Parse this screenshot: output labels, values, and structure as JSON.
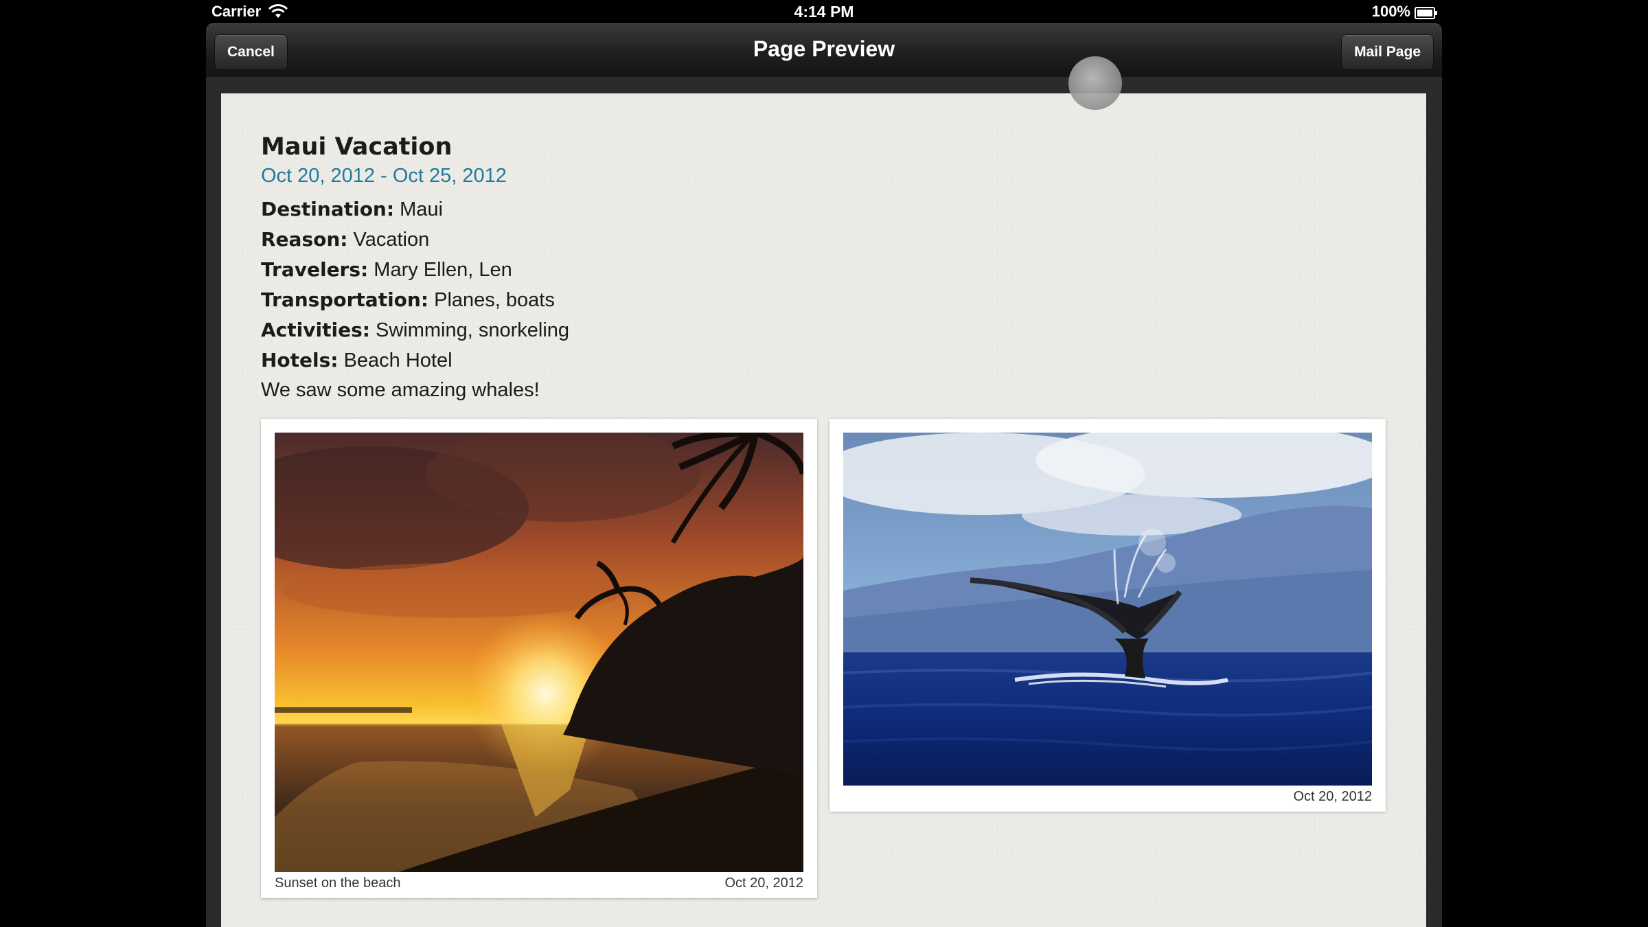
{
  "status_bar": {
    "carrier": "Carrier",
    "time": "4:14 PM",
    "battery": "100%",
    "wifi_icon": "wifi-icon",
    "battery_icon": "battery-icon"
  },
  "nav_bar": {
    "title": "Page Preview",
    "cancel_label": "Cancel",
    "mail_label": "Mail Page"
  },
  "page": {
    "title": "Maui Vacation",
    "dates": "Oct 20, 2012 - Oct 25, 2012",
    "fields": [
      {
        "label": "Destination:",
        "value": "Maui"
      },
      {
        "label": "Reason:",
        "value": "Vacation"
      },
      {
        "label": "Travelers:",
        "value": "Mary Ellen, Len"
      },
      {
        "label": "Transportation:",
        "value": "Planes, boats"
      },
      {
        "label": "Activities:",
        "value": "Swimming, snorkeling"
      },
      {
        "label": "Hotels:",
        "value": "Beach Hotel"
      }
    ],
    "note": "We saw some amazing whales!",
    "photos": [
      {
        "caption": "Sunset on the beach",
        "date": "Oct 20, 2012"
      },
      {
        "caption": "",
        "date": "Oct 20, 2012"
      }
    ]
  },
  "colors": {
    "date_accent": "#1f7a9c",
    "paper": "#ecebe6",
    "nav_bar": "#1f1f1f"
  }
}
